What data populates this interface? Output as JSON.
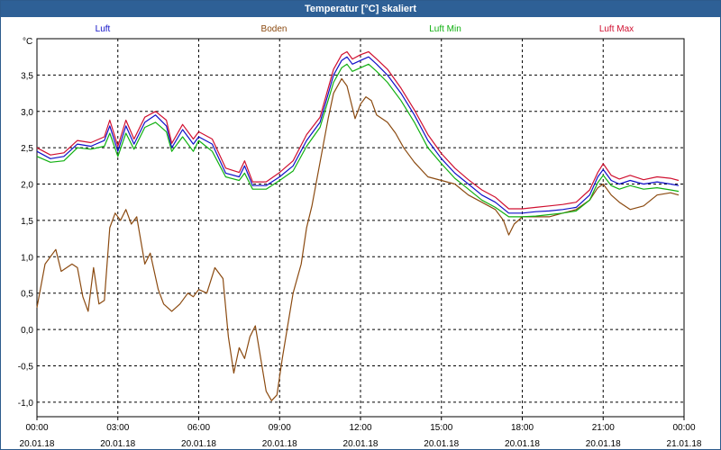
{
  "window": {
    "title": "Temperatur [°C] skaliert"
  },
  "colors": {
    "titlebar": "#2e6096",
    "Luft": "#1010c8",
    "Boden": "#8b4a10",
    "LuftMin": "#10b010",
    "LuftMax": "#d01030",
    "grid": "#000000"
  },
  "chart_data": {
    "type": "line",
    "title": "Temperatur [°C] skaliert",
    "ylabel": "°C",
    "ylim": [
      -1.2,
      4.0
    ],
    "yticks": [
      {
        "v": 3.5,
        "label": "3,5"
      },
      {
        "v": 3.0,
        "label": "3,0"
      },
      {
        "v": 2.5,
        "label": "2,5"
      },
      {
        "v": 2.0,
        "label": "2,0"
      },
      {
        "v": 1.5,
        "label": "1,5"
      },
      {
        "v": 1.0,
        "label": "1,0"
      },
      {
        "v": 0.5,
        "label": "0,5"
      },
      {
        "v": 0.0,
        "label": "0,0"
      },
      {
        "v": -0.5,
        "label": "-0,5"
      },
      {
        "v": -1.0,
        "label": "-1,0"
      }
    ],
    "xlim": [
      0,
      24
    ],
    "xticks": [
      {
        "h": 0,
        "time": "00:00",
        "date": "20.01.18"
      },
      {
        "h": 3,
        "time": "03:00",
        "date": "20.01.18"
      },
      {
        "h": 6,
        "time": "06:00",
        "date": "20.01.18"
      },
      {
        "h": 9,
        "time": "09:00",
        "date": "20.01.18"
      },
      {
        "h": 12,
        "time": "12:00",
        "date": "20.01.18"
      },
      {
        "h": 15,
        "time": "15:00",
        "date": "20.01.18"
      },
      {
        "h": 18,
        "time": "18:00",
        "date": "20.01.18"
      },
      {
        "h": 21,
        "time": "21:00",
        "date": "20.01.18"
      },
      {
        "h": 24,
        "time": "00:00",
        "date": "21.01.18"
      }
    ],
    "legend_position": "top",
    "series": [
      {
        "name": "Luft",
        "color": "#1010c8",
        "points": [
          [
            0,
            2.45
          ],
          [
            0.5,
            2.35
          ],
          [
            1,
            2.38
          ],
          [
            1.5,
            2.55
          ],
          [
            2,
            2.52
          ],
          [
            2.5,
            2.6
          ],
          [
            2.7,
            2.8
          ],
          [
            3,
            2.45
          ],
          [
            3.3,
            2.8
          ],
          [
            3.6,
            2.55
          ],
          [
            4,
            2.85
          ],
          [
            4.4,
            2.95
          ],
          [
            4.8,
            2.8
          ],
          [
            5,
            2.5
          ],
          [
            5.4,
            2.75
          ],
          [
            5.8,
            2.55
          ],
          [
            6,
            2.65
          ],
          [
            6.5,
            2.55
          ],
          [
            7,
            2.15
          ],
          [
            7.5,
            2.1
          ],
          [
            7.7,
            2.25
          ],
          [
            8,
            1.98
          ],
          [
            8.5,
            1.98
          ],
          [
            9,
            2.1
          ],
          [
            9.5,
            2.25
          ],
          [
            10,
            2.6
          ],
          [
            10.5,
            2.85
          ],
          [
            11,
            3.5
          ],
          [
            11.3,
            3.7
          ],
          [
            11.5,
            3.75
          ],
          [
            11.7,
            3.65
          ],
          [
            12,
            3.7
          ],
          [
            12.3,
            3.75
          ],
          [
            12.6,
            3.65
          ],
          [
            13,
            3.5
          ],
          [
            13.5,
            3.25
          ],
          [
            14,
            2.95
          ],
          [
            14.5,
            2.6
          ],
          [
            15,
            2.35
          ],
          [
            15.5,
            2.15
          ],
          [
            16,
            2.0
          ],
          [
            16.5,
            1.85
          ],
          [
            17,
            1.75
          ],
          [
            17.5,
            1.6
          ],
          [
            18,
            1.6
          ],
          [
            18.5,
            1.62
          ],
          [
            19,
            1.63
          ],
          [
            19.5,
            1.65
          ],
          [
            20,
            1.68
          ],
          [
            20.5,
            1.85
          ],
          [
            20.8,
            2.1
          ],
          [
            21,
            2.2
          ],
          [
            21.3,
            2.05
          ],
          [
            21.6,
            2.0
          ],
          [
            22,
            2.05
          ],
          [
            22.5,
            2.0
          ],
          [
            23,
            2.03
          ],
          [
            23.5,
            2.0
          ],
          [
            23.8,
            1.98
          ]
        ]
      },
      {
        "name": "Boden",
        "color": "#8b4a10",
        "points": [
          [
            0,
            0.3
          ],
          [
            0.3,
            0.9
          ],
          [
            0.7,
            1.1
          ],
          [
            0.9,
            0.8
          ],
          [
            1.3,
            0.9
          ],
          [
            1.5,
            0.85
          ],
          [
            1.7,
            0.45
          ],
          [
            1.9,
            0.25
          ],
          [
            2.1,
            0.85
          ],
          [
            2.3,
            0.35
          ],
          [
            2.5,
            0.4
          ],
          [
            2.7,
            1.4
          ],
          [
            2.9,
            1.6
          ],
          [
            3.1,
            1.5
          ],
          [
            3.3,
            1.65
          ],
          [
            3.5,
            1.45
          ],
          [
            3.7,
            1.55
          ],
          [
            4.0,
            0.9
          ],
          [
            4.2,
            1.05
          ],
          [
            4.5,
            0.55
          ],
          [
            4.7,
            0.35
          ],
          [
            5.0,
            0.25
          ],
          [
            5.3,
            0.35
          ],
          [
            5.6,
            0.5
          ],
          [
            5.8,
            0.45
          ],
          [
            6.0,
            0.55
          ],
          [
            6.3,
            0.5
          ],
          [
            6.6,
            0.85
          ],
          [
            6.9,
            0.7
          ],
          [
            7.1,
            -0.1
          ],
          [
            7.3,
            -0.6
          ],
          [
            7.5,
            -0.25
          ],
          [
            7.7,
            -0.4
          ],
          [
            7.9,
            -0.1
          ],
          [
            8.1,
            0.05
          ],
          [
            8.3,
            -0.4
          ],
          [
            8.5,
            -0.85
          ],
          [
            8.7,
            -0.98
          ],
          [
            8.9,
            -0.9
          ],
          [
            9.1,
            -0.4
          ],
          [
            9.3,
            0.05
          ],
          [
            9.5,
            0.5
          ],
          [
            9.8,
            0.9
          ],
          [
            10.0,
            1.4
          ],
          [
            10.2,
            1.7
          ],
          [
            10.5,
            2.3
          ],
          [
            10.8,
            2.9
          ],
          [
            11.0,
            3.25
          ],
          [
            11.3,
            3.45
          ],
          [
            11.5,
            3.35
          ],
          [
            11.8,
            2.9
          ],
          [
            12.0,
            3.1
          ],
          [
            12.2,
            3.2
          ],
          [
            12.4,
            3.15
          ],
          [
            12.6,
            2.95
          ],
          [
            13.0,
            2.85
          ],
          [
            13.3,
            2.7
          ],
          [
            13.6,
            2.5
          ],
          [
            14.0,
            2.3
          ],
          [
            14.5,
            2.1
          ],
          [
            15.0,
            2.05
          ],
          [
            15.5,
            2.0
          ],
          [
            16.0,
            1.85
          ],
          [
            16.5,
            1.75
          ],
          [
            17.0,
            1.65
          ],
          [
            17.3,
            1.5
          ],
          [
            17.5,
            1.3
          ],
          [
            17.7,
            1.45
          ],
          [
            18.0,
            1.55
          ],
          [
            18.5,
            1.55
          ],
          [
            19.0,
            1.55
          ],
          [
            19.5,
            1.6
          ],
          [
            20.0,
            1.65
          ],
          [
            20.5,
            1.78
          ],
          [
            20.8,
            1.95
          ],
          [
            21.0,
            2.0
          ],
          [
            21.3,
            1.85
          ],
          [
            21.6,
            1.75
          ],
          [
            22.0,
            1.65
          ],
          [
            22.5,
            1.7
          ],
          [
            23.0,
            1.85
          ],
          [
            23.5,
            1.88
          ],
          [
            23.8,
            1.85
          ]
        ]
      },
      {
        "name": "Luft Min",
        "color": "#10b010",
        "points": [
          [
            0,
            2.38
          ],
          [
            0.5,
            2.3
          ],
          [
            1,
            2.32
          ],
          [
            1.5,
            2.5
          ],
          [
            2,
            2.48
          ],
          [
            2.5,
            2.52
          ],
          [
            2.7,
            2.7
          ],
          [
            3,
            2.38
          ],
          [
            3.3,
            2.7
          ],
          [
            3.6,
            2.48
          ],
          [
            4,
            2.78
          ],
          [
            4.4,
            2.85
          ],
          [
            4.8,
            2.72
          ],
          [
            5,
            2.45
          ],
          [
            5.4,
            2.65
          ],
          [
            5.8,
            2.45
          ],
          [
            6,
            2.6
          ],
          [
            6.5,
            2.45
          ],
          [
            7,
            2.1
          ],
          [
            7.5,
            2.05
          ],
          [
            7.7,
            2.15
          ],
          [
            8,
            1.93
          ],
          [
            8.5,
            1.93
          ],
          [
            9,
            2.05
          ],
          [
            9.5,
            2.18
          ],
          [
            10,
            2.52
          ],
          [
            10.5,
            2.78
          ],
          [
            11,
            3.4
          ],
          [
            11.3,
            3.6
          ],
          [
            11.5,
            3.65
          ],
          [
            11.7,
            3.55
          ],
          [
            12,
            3.6
          ],
          [
            12.3,
            3.65
          ],
          [
            12.6,
            3.55
          ],
          [
            13,
            3.4
          ],
          [
            13.5,
            3.15
          ],
          [
            14,
            2.85
          ],
          [
            14.5,
            2.5
          ],
          [
            15,
            2.28
          ],
          [
            15.5,
            2.08
          ],
          [
            16,
            1.93
          ],
          [
            16.5,
            1.78
          ],
          [
            17,
            1.68
          ],
          [
            17.5,
            1.55
          ],
          [
            18,
            1.55
          ],
          [
            18.5,
            1.56
          ],
          [
            19,
            1.58
          ],
          [
            19.5,
            1.6
          ],
          [
            20,
            1.63
          ],
          [
            20.5,
            1.78
          ],
          [
            20.8,
            2.02
          ],
          [
            21,
            2.12
          ],
          [
            21.3,
            1.98
          ],
          [
            21.6,
            1.93
          ],
          [
            22,
            1.98
          ],
          [
            22.5,
            1.93
          ],
          [
            23,
            1.95
          ],
          [
            23.5,
            1.92
          ],
          [
            23.8,
            1.9
          ]
        ]
      },
      {
        "name": "Luft Max",
        "color": "#d01030",
        "points": [
          [
            0,
            2.5
          ],
          [
            0.5,
            2.4
          ],
          [
            1,
            2.43
          ],
          [
            1.5,
            2.6
          ],
          [
            2,
            2.57
          ],
          [
            2.5,
            2.65
          ],
          [
            2.7,
            2.88
          ],
          [
            3,
            2.52
          ],
          [
            3.3,
            2.88
          ],
          [
            3.6,
            2.62
          ],
          [
            4,
            2.92
          ],
          [
            4.4,
            3.0
          ],
          [
            4.8,
            2.88
          ],
          [
            5,
            2.56
          ],
          [
            5.4,
            2.82
          ],
          [
            5.8,
            2.62
          ],
          [
            6,
            2.72
          ],
          [
            6.5,
            2.62
          ],
          [
            7,
            2.22
          ],
          [
            7.5,
            2.16
          ],
          [
            7.7,
            2.32
          ],
          [
            8,
            2.03
          ],
          [
            8.5,
            2.03
          ],
          [
            9,
            2.16
          ],
          [
            9.5,
            2.32
          ],
          [
            10,
            2.68
          ],
          [
            10.5,
            2.92
          ],
          [
            11,
            3.58
          ],
          [
            11.3,
            3.78
          ],
          [
            11.5,
            3.82
          ],
          [
            11.7,
            3.72
          ],
          [
            12,
            3.78
          ],
          [
            12.3,
            3.82
          ],
          [
            12.6,
            3.72
          ],
          [
            13,
            3.58
          ],
          [
            13.5,
            3.32
          ],
          [
            14,
            3.02
          ],
          [
            14.5,
            2.68
          ],
          [
            15,
            2.42
          ],
          [
            15.5,
            2.22
          ],
          [
            16,
            2.06
          ],
          [
            16.5,
            1.92
          ],
          [
            17,
            1.82
          ],
          [
            17.5,
            1.66
          ],
          [
            18,
            1.66
          ],
          [
            18.5,
            1.68
          ],
          [
            19,
            1.7
          ],
          [
            19.5,
            1.72
          ],
          [
            20,
            1.75
          ],
          [
            20.5,
            1.92
          ],
          [
            20.8,
            2.16
          ],
          [
            21,
            2.28
          ],
          [
            21.3,
            2.12
          ],
          [
            21.6,
            2.07
          ],
          [
            22,
            2.12
          ],
          [
            22.5,
            2.06
          ],
          [
            23,
            2.1
          ],
          [
            23.5,
            2.08
          ],
          [
            23.8,
            2.05
          ]
        ]
      }
    ]
  }
}
